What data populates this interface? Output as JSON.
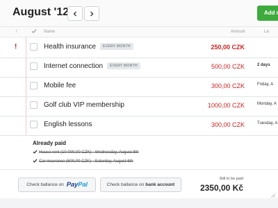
{
  "header": {
    "title": "August '12",
    "add_label": "Add ne",
    "prev_icon": "chevron-left-icon",
    "next_icon": "chevron-right-icon"
  },
  "columns": {
    "excl": "!",
    "name": "Name",
    "amount": "Amount",
    "last": "La"
  },
  "items": [
    {
      "flag": "!",
      "name": "Health insurance",
      "badge": "EVERY MONTH",
      "amount": "250,00 CZK",
      "due": ""
    },
    {
      "flag": "",
      "name": "Internet connection",
      "badge": "EVERY MONTH",
      "amount": "500,00 CZK",
      "due": "2 days"
    },
    {
      "flag": "",
      "name": "Mobile fee",
      "badge": "",
      "amount": "300,00 CZK",
      "due": "Friday, A"
    },
    {
      "flag": "",
      "name": "Golf club VIP membership",
      "badge": "",
      "amount": "1000,00 CZK",
      "due": "Monday, A"
    },
    {
      "flag": "",
      "name": "English lessons",
      "badge": "",
      "amount": "300,00 CZK",
      "due": "Tuesday, A"
    }
  ],
  "paid": {
    "title": "Already paid",
    "items": [
      {
        "name": "House rent (10 000,00 CZK)",
        "date": " - Wednesday, August 8th"
      },
      {
        "name": "Car insurance (600,00 CZK)",
        "date": " - Saturday, August 6th"
      }
    ]
  },
  "footer": {
    "paypal_prefix": "Check ballance on",
    "paypal_a": "Pay",
    "paypal_b": "Pal",
    "bank_prefix": "Check ballance on",
    "bank_strong": "bank account",
    "total_label": "Still to be paid",
    "total_value": "2350,00 Kč"
  },
  "colors": {
    "accent_green": "#3daa3d",
    "alert_red": "#d02020",
    "paypal_dark": "#1c3f8f",
    "paypal_light": "#1a9fde"
  }
}
